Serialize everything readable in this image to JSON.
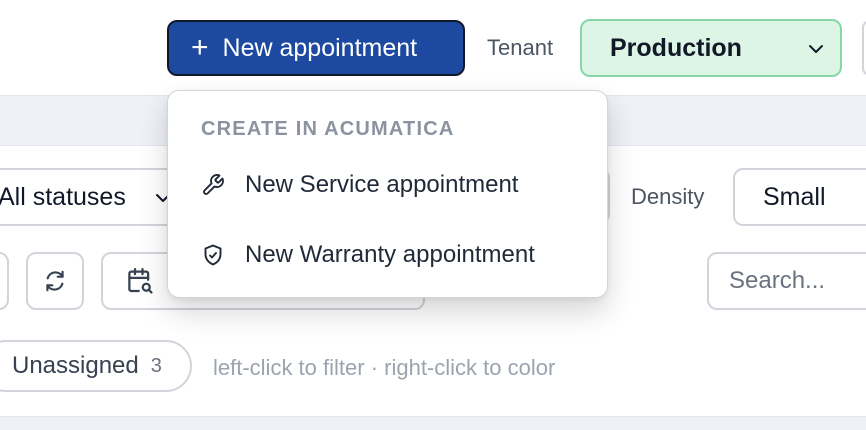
{
  "toolbar": {
    "new_button_label": "New appointment",
    "tenant_label": "Tenant",
    "tenant_value": "Production"
  },
  "filters": {
    "status_value": "All statuses",
    "density_label": "Density",
    "density_value": "Small",
    "search_placeholder": "Search..."
  },
  "legend": {
    "chip_label": "Unassigned",
    "chip_count": "3",
    "hint": "left-click to filter · right-click to color"
  },
  "menu": {
    "header": "CREATE IN ACUMATICA",
    "items": [
      {
        "label": "New Service appointment",
        "icon": "wrench-icon"
      },
      {
        "label": "New Warranty appointment",
        "icon": "shield-icon"
      }
    ]
  },
  "colors": {
    "primary": "#1d4aa0",
    "tenant_bg": "#dcf5e4",
    "tenant_border": "#86d6a6"
  }
}
